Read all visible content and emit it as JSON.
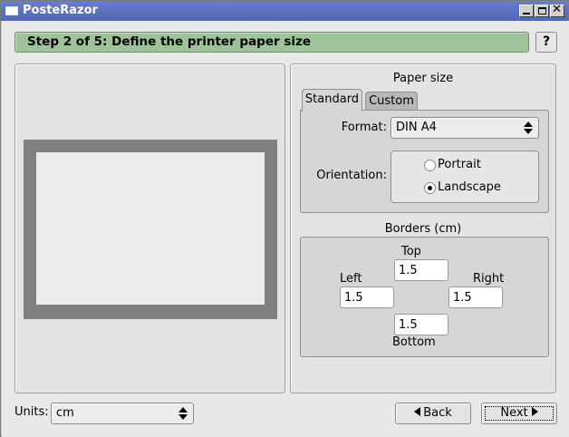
{
  "window": {
    "title": "PosteRazor"
  },
  "header": {
    "step_title": "Step 2 of 5: Define the printer paper size",
    "help_label": "?"
  },
  "settings": {
    "paper_size_label": "Paper size",
    "tabs": [
      {
        "label": "Standard",
        "active": true
      },
      {
        "label": "Custom",
        "active": false
      }
    ],
    "format_label": "Format:",
    "format_value": "DIN A4",
    "orientation_label": "Orientation:",
    "orientations": [
      {
        "label": "Portrait",
        "checked": false
      },
      {
        "label": "Landscape",
        "checked": true
      }
    ],
    "borders_label": "Borders (cm)",
    "borders": {
      "top_label": "Top",
      "top": "1.5",
      "left_label": "Left",
      "left": "1.5",
      "right_label": "Right",
      "right": "1.5",
      "bottom_label": "Bottom",
      "bottom": "1.5"
    }
  },
  "footer": {
    "units_label": "Units:",
    "units_value": "cm",
    "back_label": "Back",
    "next_label": "Next"
  },
  "colors": {
    "titlebar": "#5b71c0",
    "stepbar": "#9ec29a",
    "paper_border": "#808080",
    "paper": "#ebebeb"
  },
  "icons": {
    "back": "arrow-left-icon",
    "next": "arrow-right-icon"
  }
}
